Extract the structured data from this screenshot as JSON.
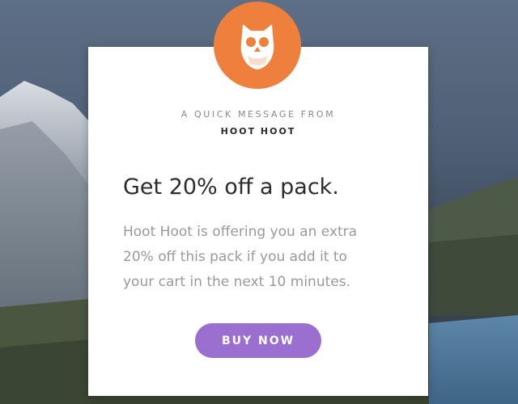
{
  "background": {
    "image": "mountain-lake-landscape"
  },
  "modal": {
    "badge_icon": "owl-icon",
    "eyebrow": "A QUICK MESSAGE FROM",
    "brand": "HOOT HOOT",
    "headline": "Get 20% off a pack.",
    "body_lines": [
      "Hoot Hoot is offering you an extra",
      "20% off  this pack if you add it to",
      "your cart in the next 10 minutes."
    ],
    "cta_label": "BUY NOW"
  },
  "colors": {
    "badge": "#ee7f3c",
    "cta": "#9b6fd0",
    "card": "#ffffff"
  }
}
